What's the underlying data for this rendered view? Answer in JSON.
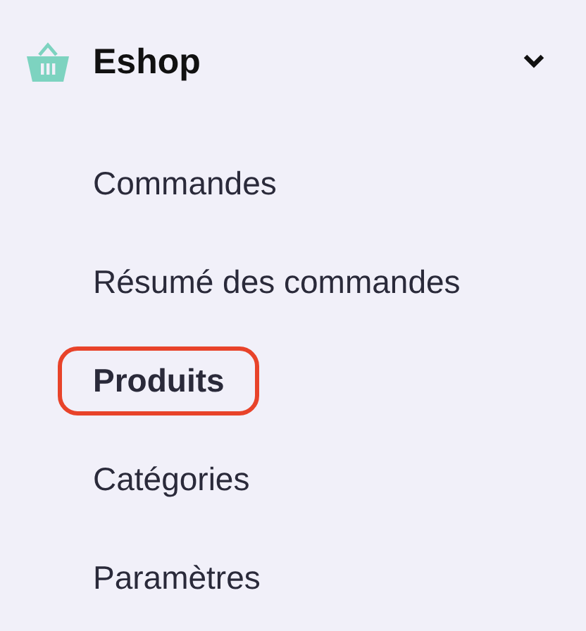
{
  "section": {
    "title": "Eshop",
    "expanded": true
  },
  "items": [
    {
      "label": "Commandes",
      "selected": false
    },
    {
      "label": "Résumé des commandes",
      "selected": false
    },
    {
      "label": "Produits",
      "selected": true
    },
    {
      "label": "Catégories",
      "selected": false
    },
    {
      "label": "Paramètres",
      "selected": false
    }
  ]
}
